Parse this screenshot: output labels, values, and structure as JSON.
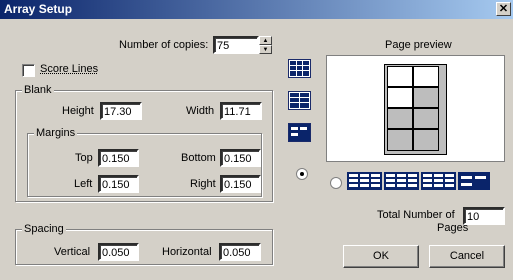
{
  "window": {
    "title": "Array Setup",
    "close_glyph": "✕"
  },
  "copies": {
    "label": "Number of copies:",
    "value": "75"
  },
  "score_lines": {
    "label": "Score Lines",
    "checked": false
  },
  "blank": {
    "title": "Blank",
    "height_label": "Height",
    "height_value": "17.30",
    "width_label": "Width",
    "width_value": "11.71"
  },
  "margins": {
    "title": "Margins",
    "top_label": "Top",
    "top_value": "0.150",
    "bottom_label": "Bottom",
    "bottom_value": "0.150",
    "left_label": "Left",
    "left_value": "0.150",
    "right_label": "Right",
    "right_value": "0.150"
  },
  "spacing": {
    "title": "Spacing",
    "vertical_label": "Vertical",
    "vertical_value": "0.050",
    "horizontal_label": "Horizontal",
    "horizontal_value": "0.050"
  },
  "preview": {
    "title": "Page preview"
  },
  "total": {
    "label_line1": "Total Number of",
    "label_line2": "Pages",
    "value": "10"
  },
  "buttons": {
    "ok": "OK",
    "cancel": "Cancel"
  },
  "icons": {
    "layout_icons": [
      "layout-grid-2x3-icon",
      "layout-grid-2x3-icon",
      "layout-grid-2x2-selected-icon"
    ],
    "layout_strip": [
      "layout-grid-3x3-icon",
      "layout-grid-3x3-icon",
      "layout-grid-3x3-icon",
      "layout-grid-2x2-icon"
    ]
  },
  "colors": {
    "titlebar": "#0a246a",
    "dialog": "#d4d0c8",
    "selected_icon": "#0a246a"
  }
}
